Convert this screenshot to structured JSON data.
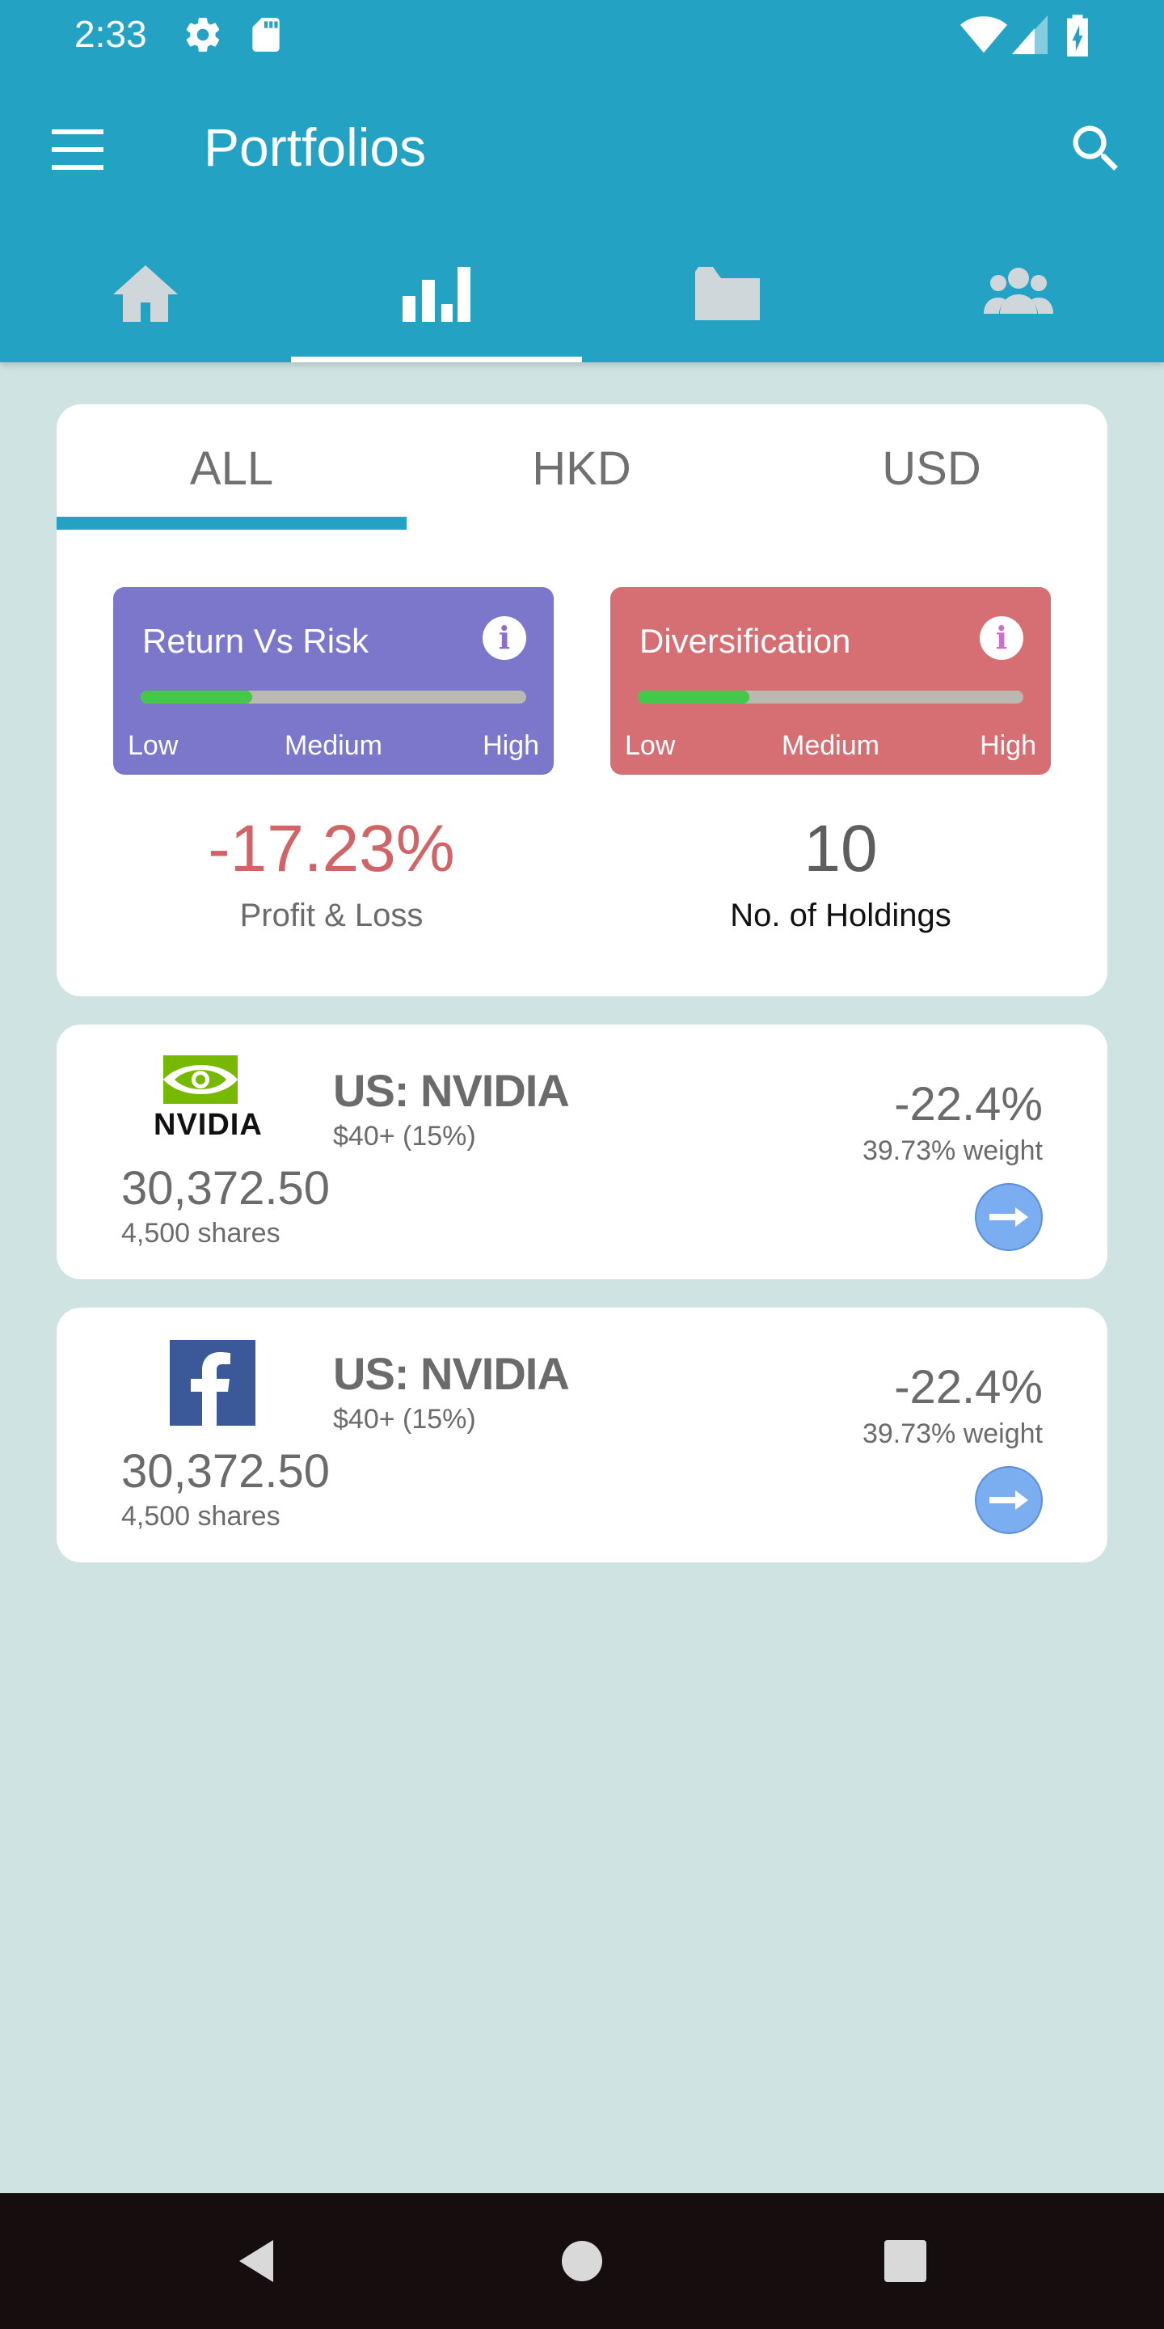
{
  "status_bar": {
    "time": "2:33",
    "icons": [
      "gear-icon",
      "sd-card-icon",
      "wifi-icon",
      "signal-icon",
      "battery-charging-icon"
    ]
  },
  "toolbar": {
    "title": "Portfolios",
    "menu_icon": "menu-icon",
    "search_icon": "search-icon"
  },
  "nav_tabs": [
    {
      "icon": "home-icon",
      "active": false
    },
    {
      "icon": "bar-chart-icon",
      "active": true
    },
    {
      "icon": "folder-icon",
      "active": false
    },
    {
      "icon": "group-icon",
      "active": false
    }
  ],
  "summary": {
    "currency_tabs": [
      "ALL",
      "HKD",
      "USD"
    ],
    "selected_tab": "ALL",
    "return_vs_risk": {
      "title": "Return Vs Risk",
      "level": 0.29,
      "labels": [
        "Low",
        "Medium",
        "High"
      ],
      "color": "#7b78cc"
    },
    "diversification": {
      "title": "Diversification",
      "level": 0.29,
      "labels": [
        "Low",
        "Medium",
        "High"
      ],
      "color": "#d66f73"
    },
    "profit_loss": {
      "value": "-17.23%",
      "label": "Profit & Loss",
      "color": "#d06466"
    },
    "holdings_count": {
      "value": "10",
      "label": "No. of Holdings"
    }
  },
  "holdings": [
    {
      "logo": "nvidia-logo",
      "logo_text": "NVIDIA",
      "name": "US: NVIDIA",
      "price": "$40+ (15%)",
      "value": "30,372.50",
      "shares": "4,500 shares",
      "change": "-22.4%",
      "weight": "39.73% weight"
    },
    {
      "logo": "facebook-logo",
      "name": "US: NVIDIA",
      "price": "$40+ (15%)",
      "value": "30,372.50",
      "shares": "4,500 shares",
      "change": "-22.4%",
      "weight": "39.73% weight"
    }
  ],
  "colors": {
    "app_bar": "#23a2c4",
    "background": "#cfe3e2",
    "accent": "#23a2c4",
    "progress_fill": "#44c84a"
  }
}
